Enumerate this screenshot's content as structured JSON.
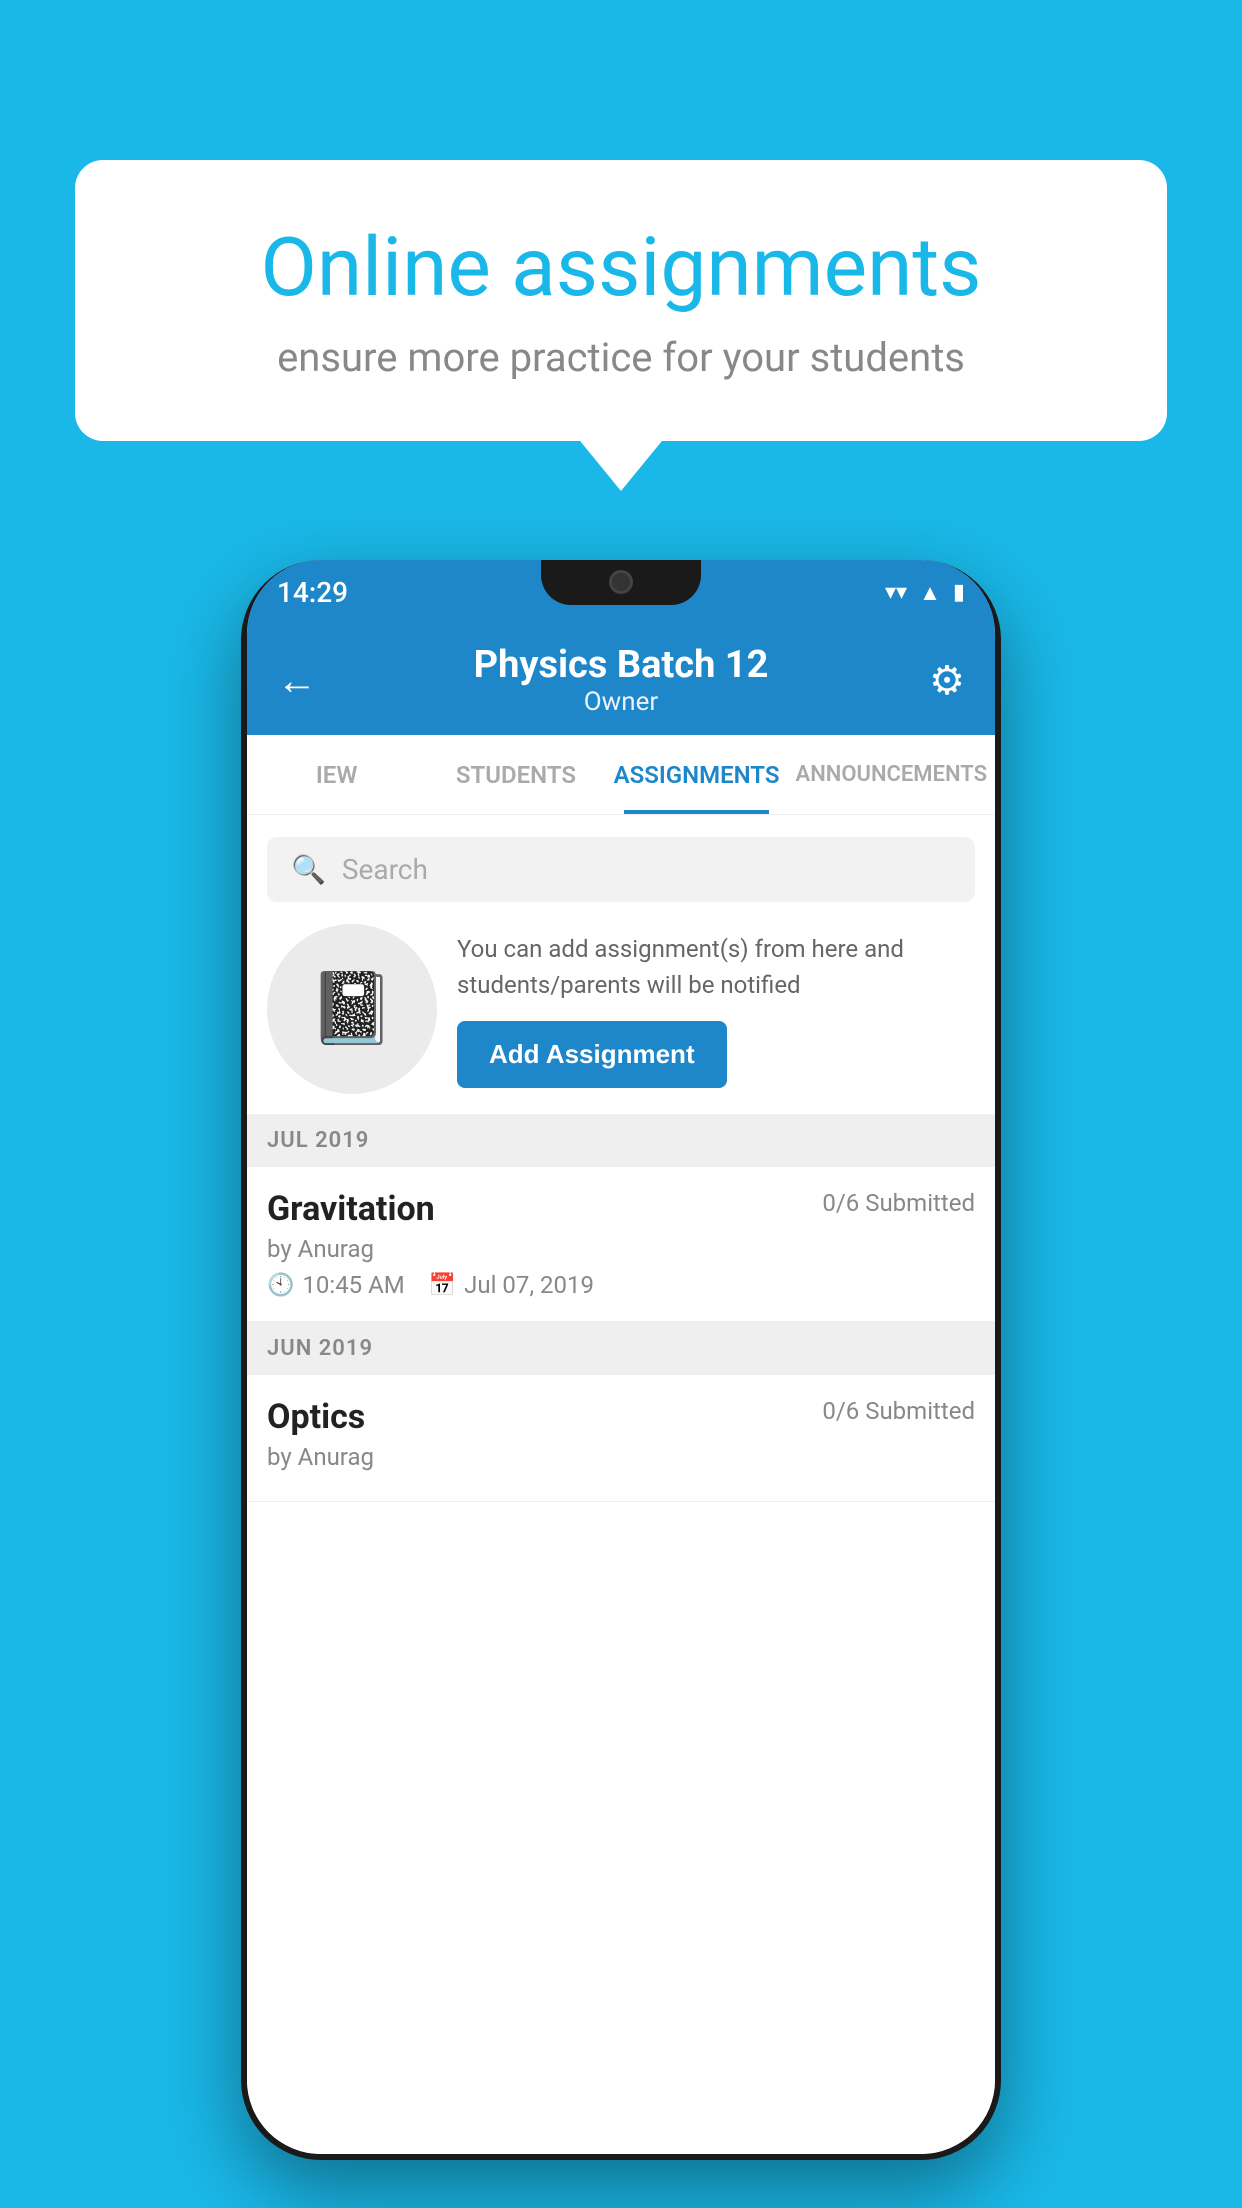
{
  "background_color": "#1ab8e8",
  "speech_bubble": {
    "title": "Online assignments",
    "subtitle": "ensure more practice for your students"
  },
  "phone": {
    "status_bar": {
      "time": "14:29",
      "wifi": "▼",
      "signal": "▲",
      "battery": "▮"
    },
    "header": {
      "back_label": "←",
      "title": "Physics Batch 12",
      "subtitle": "Owner",
      "settings_label": "⚙"
    },
    "tabs": [
      {
        "label": "IEW",
        "active": false
      },
      {
        "label": "STUDENTS",
        "active": false
      },
      {
        "label": "ASSIGNMENTS",
        "active": true
      },
      {
        "label": "ANNOUNCEMENTS",
        "active": false
      }
    ],
    "search": {
      "placeholder": "Search"
    },
    "promo": {
      "description": "You can add assignment(s) from here and students/parents will be notified",
      "button_label": "Add Assignment"
    },
    "sections": [
      {
        "title": "JUL 2019",
        "assignments": [
          {
            "name": "Gravitation",
            "submitted": "0/6 Submitted",
            "by": "by Anurag",
            "time": "10:45 AM",
            "date": "Jul 07, 2019"
          }
        ]
      },
      {
        "title": "JUN 2019",
        "assignments": [
          {
            "name": "Optics",
            "submitted": "0/6 Submitted",
            "by": "by Anurag",
            "time": "",
            "date": ""
          }
        ]
      }
    ]
  }
}
